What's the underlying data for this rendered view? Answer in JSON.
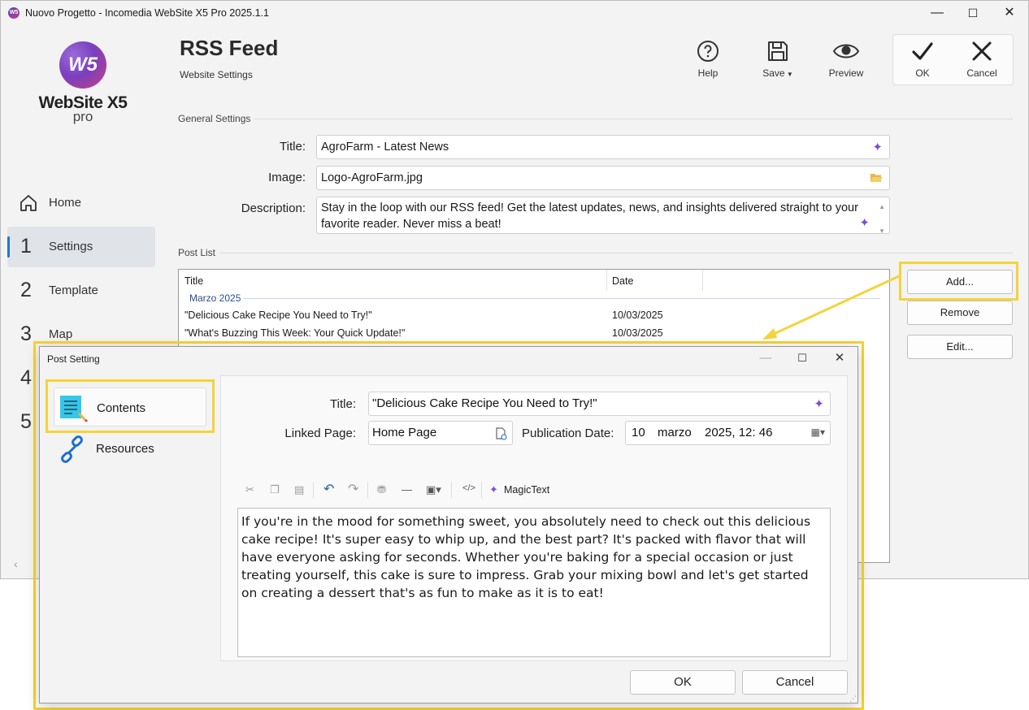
{
  "window": {
    "title": "Nuovo Progetto - Incomedia WebSite X5 Pro 2025.1.1",
    "minimize": "—",
    "maximize": "☐",
    "close": "✕"
  },
  "logo": {
    "mark": "W5",
    "name": "WebSite X5",
    "edition": "pro"
  },
  "nav": [
    {
      "num": "",
      "label": "Home"
    },
    {
      "num": "1",
      "label": "Settings"
    },
    {
      "num": "2",
      "label": "Template"
    },
    {
      "num": "3",
      "label": "Map"
    },
    {
      "num": "4",
      "label": ""
    },
    {
      "num": "5",
      "label": ""
    }
  ],
  "header": {
    "title": "RSS Feed",
    "subtitle": "Website Settings"
  },
  "toolbar": {
    "help": "Help",
    "save": "Save",
    "preview": "Preview",
    "ok": "OK",
    "cancel": "Cancel"
  },
  "general": {
    "section": "General Settings",
    "title_label": "Title:",
    "title_value": "AgroFarm - Latest News",
    "image_label": "Image:",
    "image_value": "Logo-AgroFarm.jpg",
    "description_label": "Description:",
    "description_value": "Stay in the loop with our RSS feed! Get the latest updates, news, and insights delivered straight to your favorite reader. Never miss a beat!"
  },
  "post_list": {
    "section": "Post List",
    "col_title": "Title",
    "col_date": "Date",
    "group": "Marzo 2025",
    "rows": [
      {
        "title": "\"Delicious Cake Recipe You Need to Try!\"",
        "date": "10/03/2025"
      },
      {
        "title": "\"What's Buzzing This Week: Your Quick Update!\"",
        "date": "10/03/2025"
      }
    ],
    "add": "Add...",
    "remove": "Remove",
    "edit": "Edit..."
  },
  "dialog": {
    "title": "Post Setting",
    "tab_contents": "Contents",
    "tab_resources": "Resources",
    "title_label": "Title:",
    "title_value": "\"Delicious Cake Recipe You Need to Try!\"",
    "linked_label": "Linked Page:",
    "linked_value": "Home Page",
    "pub_label": "Publication Date:",
    "pub_day": "10",
    "pub_month": "marzo",
    "pub_year_time": "2025, 12: 46",
    "magic_text": "MagicText",
    "body": "If you're in the mood for something sweet, you absolutely need to check out this delicious cake recipe! It's super easy to whip up, and the best part? It's packed with flavor that will have everyone asking for seconds. Whether you're baking for a special occasion or just treating yourself, this cake is sure to impress. Grab your mixing bowl and let's get started on creating a dessert that's as fun to make as it is to eat!",
    "ok": "OK",
    "cancel": "Cancel"
  },
  "colors": {
    "highlight": "#f5d33a",
    "accent": "#1e78c8",
    "group": "#2b4d8c"
  }
}
